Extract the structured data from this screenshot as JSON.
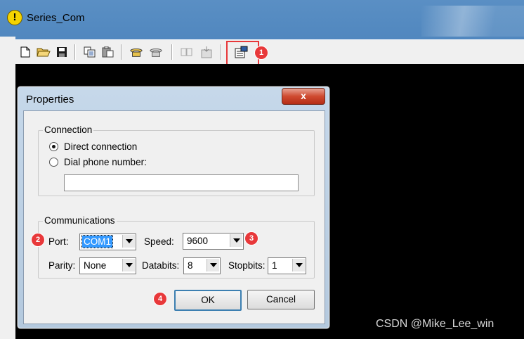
{
  "app": {
    "title": "Series_Com",
    "icon_glyph": "!"
  },
  "toolbar": {
    "buttons": [
      "new-icon",
      "open-icon",
      "save-icon",
      "copy-icon",
      "paste-icon",
      "call-icon",
      "disconnect-icon",
      "send-icon",
      "receive-icon",
      "properties-icon"
    ]
  },
  "callouts": {
    "c1": "1",
    "c2": "2",
    "c3": "3",
    "c4": "4"
  },
  "dialog": {
    "title": "Properties",
    "close_glyph": "x",
    "connection": {
      "group_label": "Connection",
      "direct_label": "Direct connection",
      "dial_label": "Dial phone number:",
      "phone_value": ""
    },
    "communications": {
      "group_label": "Communications",
      "port_label": "Port:",
      "port_value": "COM1",
      "speed_label": "Speed:",
      "speed_value": "9600",
      "parity_label": "Parity:",
      "parity_value": "None",
      "databits_label": "Databits:",
      "databits_value": "8",
      "stopbits_label": "Stopbits:",
      "stopbits_value": "1"
    },
    "ok_label": "OK",
    "cancel_label": "Cancel"
  },
  "watermark": "CSDN @Mike_Lee_win",
  "colors": {
    "accent": "#e8383a",
    "selection": "#3399ff",
    "terminal": "#000000"
  }
}
